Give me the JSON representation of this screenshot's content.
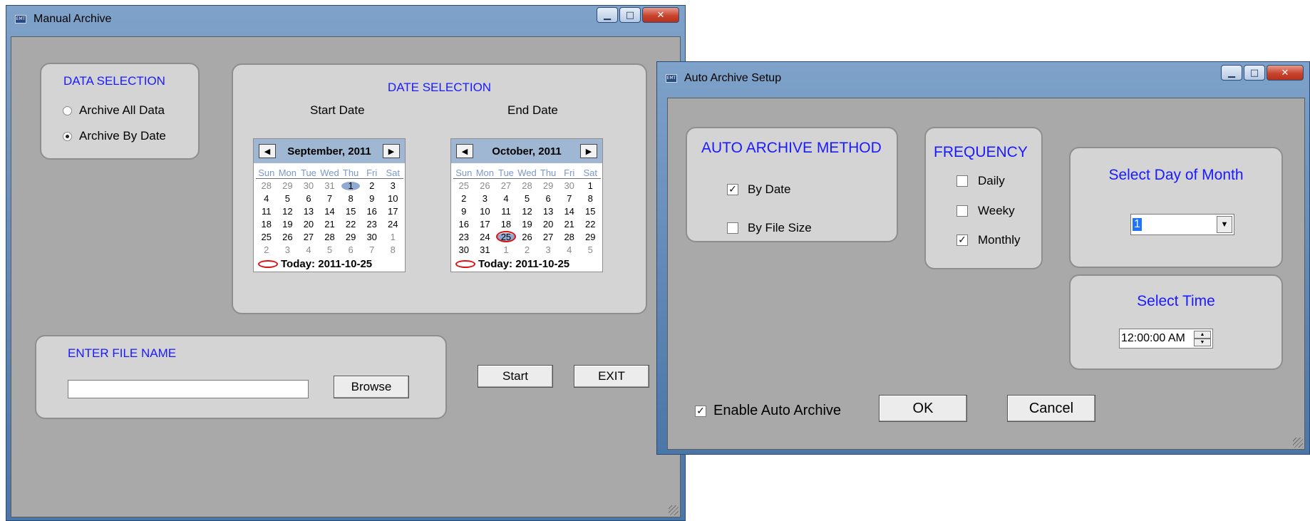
{
  "manual": {
    "title": "Manual Archive",
    "data_selection": {
      "heading": "DATA SELECTION",
      "options": [
        {
          "label": "Archive All Data",
          "selected": false
        },
        {
          "label": "Archive By Date",
          "selected": true
        }
      ]
    },
    "date_selection": {
      "heading": "DATE SELECTION",
      "start_label": "Start Date",
      "end_label": "End Date"
    },
    "weekdays": [
      "Sun",
      "Mon",
      "Tue",
      "Wed",
      "Thu",
      "Fri",
      "Sat"
    ],
    "cal_start": {
      "title": "September, 2011",
      "rows": [
        [
          "28",
          "29",
          "30",
          "31",
          "1",
          "2",
          "3"
        ],
        [
          "4",
          "5",
          "6",
          "7",
          "8",
          "9",
          "10"
        ],
        [
          "11",
          "12",
          "13",
          "14",
          "15",
          "16",
          "17"
        ],
        [
          "18",
          "19",
          "20",
          "21",
          "22",
          "23",
          "24"
        ],
        [
          "25",
          "26",
          "27",
          "28",
          "29",
          "30",
          "1"
        ],
        [
          "2",
          "3",
          "4",
          "5",
          "6",
          "7",
          "8"
        ]
      ],
      "today": "Today: 2011-10-25"
    },
    "cal_end": {
      "title": "October, 2011",
      "rows": [
        [
          "25",
          "26",
          "27",
          "28",
          "29",
          "30",
          "1"
        ],
        [
          "2",
          "3",
          "4",
          "5",
          "6",
          "7",
          "8"
        ],
        [
          "9",
          "10",
          "11",
          "12",
          "13",
          "14",
          "15"
        ],
        [
          "16",
          "17",
          "18",
          "19",
          "20",
          "21",
          "22"
        ],
        [
          "23",
          "24",
          "25",
          "26",
          "27",
          "28",
          "29"
        ],
        [
          "30",
          "31",
          "1",
          "2",
          "3",
          "4",
          "5"
        ]
      ],
      "today": "Today: 2011-10-25"
    },
    "file": {
      "heading": "ENTER FILE NAME",
      "value": "",
      "browse_label": "Browse"
    },
    "start_label": "Start",
    "exit_label": "EXIT"
  },
  "auto": {
    "title": "Auto Archive Setup",
    "method": {
      "heading": "AUTO ARCHIVE METHOD",
      "by_date": {
        "label": "By Date",
        "checked": true
      },
      "by_size": {
        "label": "By File Size",
        "checked": false
      }
    },
    "frequency": {
      "heading": "FREQUENCY",
      "daily": {
        "label": "Daily",
        "checked": false
      },
      "weekly": {
        "label": "Weeky",
        "checked": false
      },
      "monthly": {
        "label": "Monthly",
        "checked": true
      }
    },
    "day_of_month": {
      "heading": "Select Day of Month",
      "value": "1"
    },
    "time": {
      "heading": "Select Time",
      "value": "12:00:00 AM"
    },
    "enable": {
      "label": "Enable Auto Archive",
      "checked": true
    },
    "ok_label": "OK",
    "cancel_label": "Cancel"
  },
  "colors": {
    "heading_blue": "#1a1aff",
    "panel": "#d4d4d4",
    "client": "#a9a9a9",
    "title_bar": "#6c8fbb"
  },
  "icons": [
    "app-icon",
    "minimize-icon",
    "maximize-icon",
    "close-icon",
    "chevron-left-icon",
    "chevron-right-icon",
    "chevron-down-icon",
    "spin-up-icon",
    "spin-down-icon",
    "check-icon",
    "resize-grip-icon"
  ]
}
